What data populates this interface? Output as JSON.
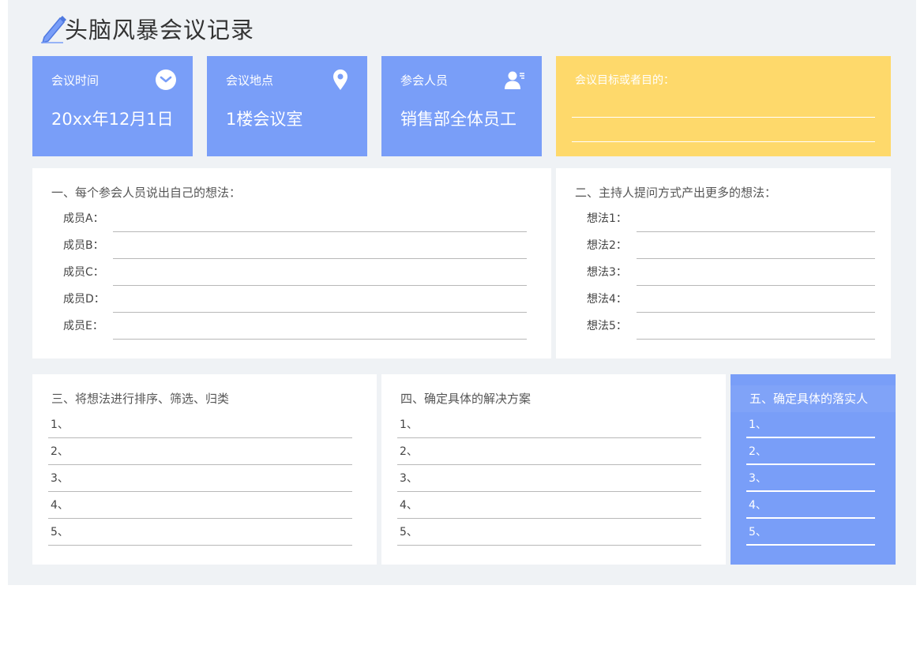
{
  "title": "头脑风暴会议记录",
  "colors": {
    "blue": "#799ef8",
    "yellow": "#fed96b",
    "background": "#eff2f5"
  },
  "info_cards": [
    {
      "label": "会议时间",
      "value": "20xx年12月1日",
      "icon": "clock-icon"
    },
    {
      "label": "会议地点",
      "value": "1楼会议室",
      "icon": "location-pin-icon"
    },
    {
      "label": "参会人员",
      "value": "销售部全体员工",
      "icon": "person-icon"
    }
  ],
  "goal": {
    "label": "会议目标或者目的："
  },
  "section1": {
    "heading": "一、每个参会人员说出自己的想法：",
    "rows": [
      "成员A：",
      "成员B：",
      "成员C：",
      "成员D：",
      "成员E："
    ]
  },
  "section2": {
    "heading": "二、主持人提问方式产出更多的想法：",
    "rows": [
      "想法1：",
      "想法2：",
      "想法3：",
      "想法4：",
      "想法5："
    ]
  },
  "section3": {
    "heading": "三、将想法进行排序、筛选、归类",
    "rows": [
      "1、",
      "2、",
      "3、",
      "4、",
      "5、"
    ]
  },
  "section4": {
    "heading": "四、确定具体的解决方案",
    "rows": [
      "1、",
      "2、",
      "3、",
      "4、",
      "5、"
    ]
  },
  "section5": {
    "heading": "五、确定具体的落实人",
    "rows": [
      "1、",
      "2、",
      "3、",
      "4、",
      "5、"
    ]
  }
}
